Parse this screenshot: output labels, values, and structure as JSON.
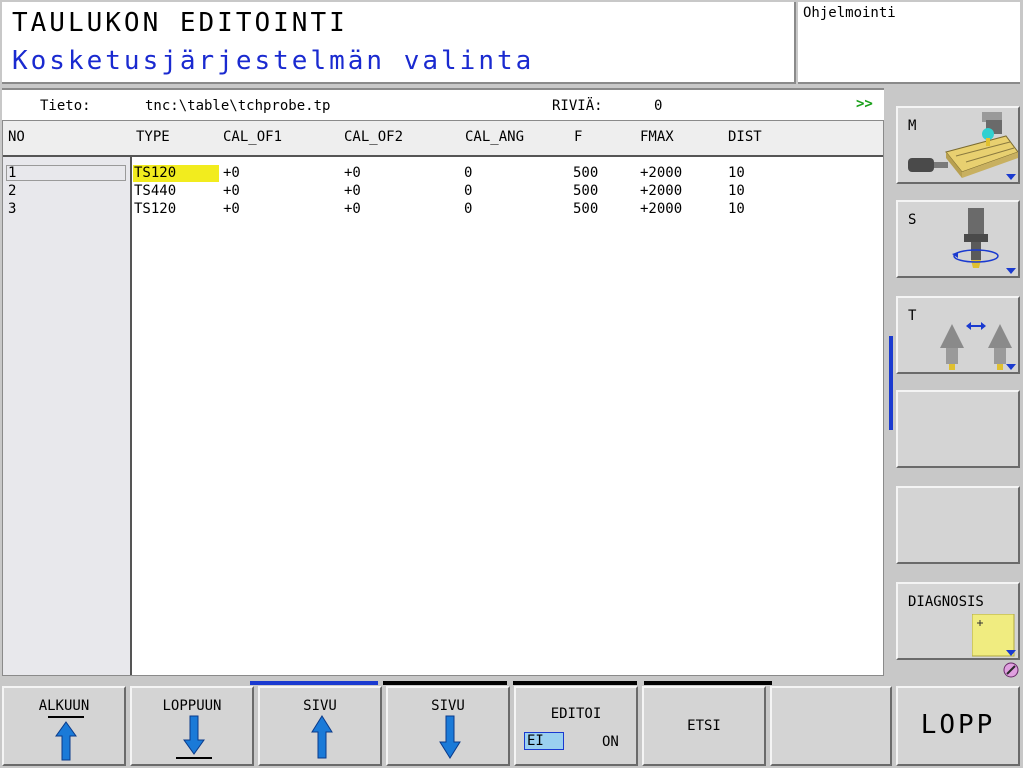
{
  "header": {
    "title": "TAULUKON EDITOINTI",
    "subtitle": "Kosketusjärjestelmän valinta",
    "mode": "Ohjelmointi"
  },
  "info": {
    "file_label": "Tieto:",
    "file_path": "tnc:\\table\\tchprobe.tp",
    "rows_label": "RIVIÄ:",
    "rows_value": "0",
    "more": ">>"
  },
  "table": {
    "columns": [
      "NO",
      "TYPE",
      "CAL_OF1",
      "CAL_OF2",
      "CAL_ANG",
      "F",
      "FMAX",
      "DIST"
    ],
    "rows": [
      [
        "1",
        "TS120",
        "+0",
        "+0",
        "0",
        "500",
        "+2000",
        "10"
      ],
      [
        "2",
        "TS440",
        "+0",
        "+0",
        "0",
        "500",
        "+2000",
        "10"
      ],
      [
        "3",
        "TS120",
        "+0",
        "+0",
        "0",
        "500",
        "+2000",
        "10"
      ]
    ]
  },
  "side_softkeys": [
    {
      "label": "M",
      "icon": "machine-table-icon"
    },
    {
      "label": "S",
      "icon": "spindle-icon"
    },
    {
      "label": "T",
      "icon": "tool-change-icon"
    },
    {
      "label": "",
      "icon": ""
    },
    {
      "label": "",
      "icon": ""
    },
    {
      "label": "DIAGNOSIS",
      "icon": "diagnosis-icon"
    }
  ],
  "bottom_softkeys": {
    "begin": "ALKUUN",
    "end": "LOPPUUN",
    "page_up": "SIVU",
    "page_down": "SIVU",
    "edit": {
      "label": "EDITOI",
      "off": "EI",
      "on": "ON"
    },
    "find": "ETSI",
    "blank": "",
    "exit": "LOPP"
  },
  "colors": {
    "title_blue": "#1a2ad0",
    "highlight": "#f2ec1e",
    "arrow_blue": "#1a7ad8",
    "scroll_blue": "#1a3ad0",
    "more_green": "#1aa01a"
  }
}
